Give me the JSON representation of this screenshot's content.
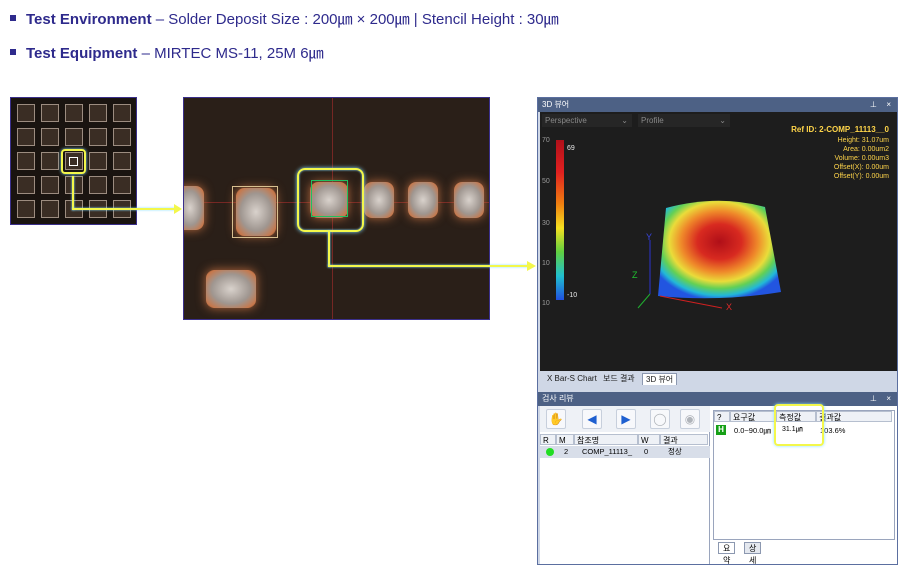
{
  "bullets": {
    "line1_bold": "Test Environment",
    "line1_rest": " –  Solder Deposit Size : 200㎛ × 200㎛ | Stencil Height : 30㎛",
    "line2_bold": "Test Equipment",
    "line2_rest": " – MIRTEC MS-11, 25M 6㎛"
  },
  "viewer": {
    "title": "3D 뷰어",
    "pin": "ₓ",
    "close": "×",
    "dropdown1": "Perspective",
    "dropdown2": "Profile",
    "ref_id": "Ref ID: 2-COMP_11113__0",
    "height": "Height: 31.07um",
    "area": "Area: 0.00um2",
    "volume": "Volume: 0.00um3",
    "offset_x": "Offset(X): 0.00um",
    "offset_y": "Offset(Y): 0.00um",
    "scale_ticks": [
      "70",
      "50",
      "30",
      "10",
      "10"
    ],
    "scale_max_label": "69",
    "scale_min_label": "-10",
    "axis_x": "X",
    "axis_y": "Y",
    "axis_z": "Z",
    "tabs": [
      "X Bar-S Chart",
      "보드 결과",
      "3D 뷰어"
    ]
  },
  "review": {
    "title": "검사 리뷰",
    "toolbar_icons": [
      "hand-icon",
      "arrow-left-icon",
      "arrow-right-icon",
      "circle-icon",
      "circle-check-icon"
    ],
    "headers": [
      "R",
      "M",
      "참조명",
      "W",
      "결과"
    ],
    "row": {
      "m": "2",
      "ref": "COMP_11113_",
      "w": "0",
      "result": "정상"
    },
    "right_headers": [
      "?",
      "요구값",
      "측정값",
      "결과값"
    ],
    "right_row": {
      "badge": "H",
      "required": "0.0~90.0㎛",
      "measured": "31.1㎛",
      "result": "103.6%"
    },
    "bottom_tabs": [
      "요약",
      "상세"
    ]
  },
  "colors": {
    "bullet": "#2e2a8c",
    "highlight": "#f3f74b",
    "info_text": "#ffd54a"
  }
}
